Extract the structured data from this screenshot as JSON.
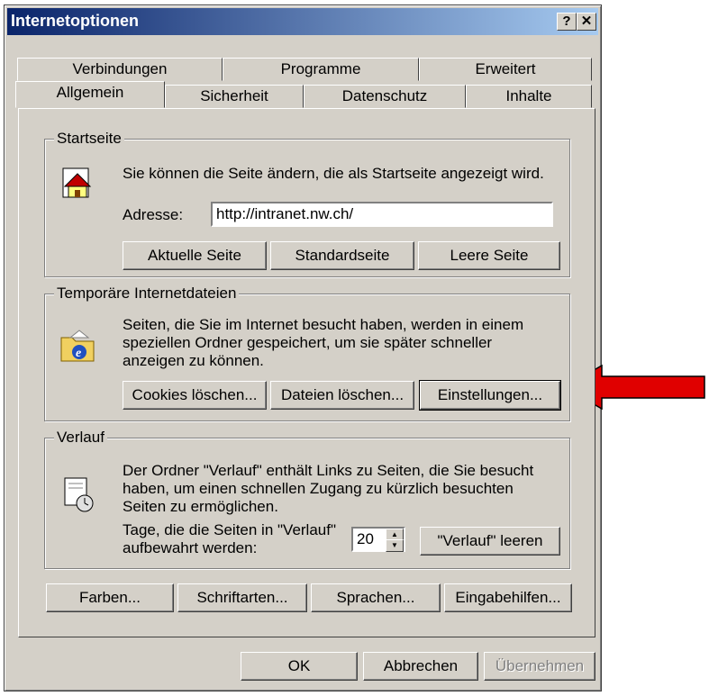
{
  "window": {
    "title": "Internetoptionen",
    "help_btn": "?",
    "close_btn": "✕"
  },
  "tabs_back": [
    "Verbindungen",
    "Programme",
    "Erweitert"
  ],
  "tabs_front": [
    "Allgemein",
    "Sicherheit",
    "Datenschutz",
    "Inhalte"
  ],
  "startseite": {
    "group_label": "Startseite",
    "description": "Sie können die Seite ändern, die als Startseite angezeigt wird.",
    "address_label": "Adresse:",
    "address_value": "http://intranet.nw.ch/",
    "buttons": [
      "Aktuelle Seite",
      "Standardseite",
      "Leere Seite"
    ]
  },
  "temp": {
    "group_label": "Temporäre Internetdateien",
    "description_lines": [
      "Seiten, die Sie im Internet besucht haben, werden in einem",
      "speziellen Ordner gespeichert, um sie später schneller",
      "anzeigen zu können."
    ],
    "buttons": [
      "Cookies löschen...",
      "Dateien löschen...",
      "Einstellungen..."
    ]
  },
  "verlauf": {
    "group_label": "Verlauf",
    "description_lines": [
      "Der Ordner \"Verlauf\" enthält Links zu Seiten, die Sie besucht",
      "haben, um einen schnellen Zugang zu kürzlich besuchten",
      "Seiten zu ermöglichen."
    ],
    "days_label_lines": [
      "Tage, die die Seiten in \"Verlauf\"",
      "aufbewahrt werden:"
    ],
    "days_value": "20",
    "clear_button": "\"Verlauf\" leeren"
  },
  "bottom_buttons": [
    "Farben...",
    "Schriftarten...",
    "Sprachen...",
    "Eingabehilfen..."
  ],
  "dialog_buttons": {
    "ok": "OK",
    "cancel": "Abbrechen",
    "apply": "Übernehmen"
  },
  "colors": {
    "titlebar": "#0a246a",
    "face": "#d4d0c8",
    "arrow": "#e00000"
  }
}
